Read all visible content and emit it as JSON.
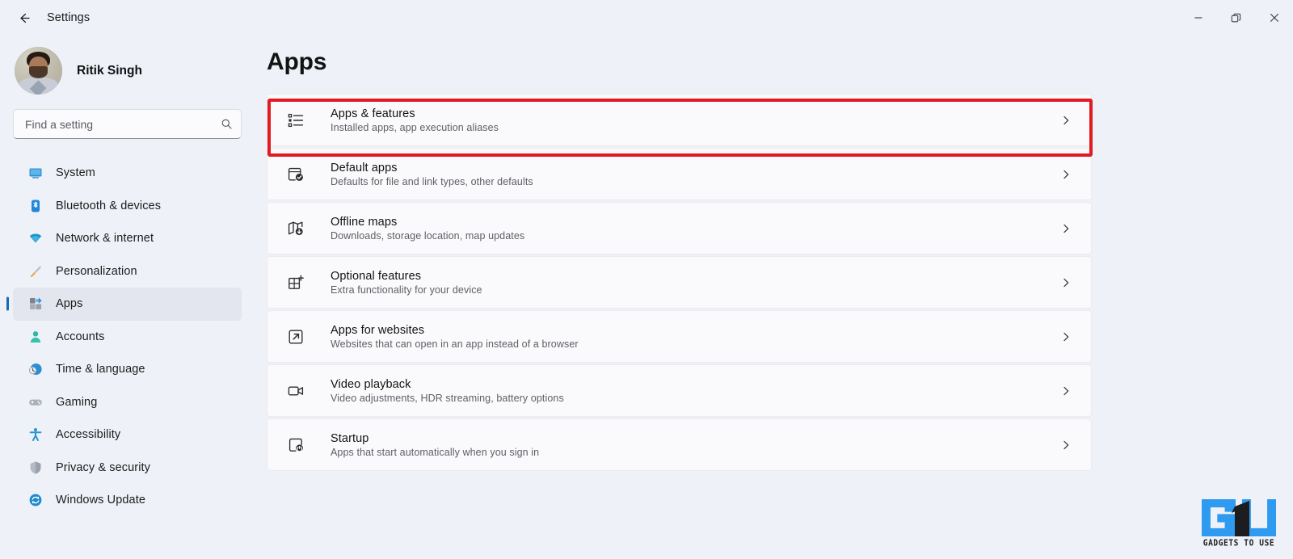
{
  "window": {
    "back_icon": "arrow-left-icon",
    "title": "Settings",
    "controls": {
      "minimize": "minimize-icon",
      "restore": "restore-icon",
      "close": "close-icon"
    }
  },
  "sidebar": {
    "account": {
      "name": "Ritik Singh",
      "avatar": "user-avatar"
    },
    "search": {
      "placeholder": "Find a setting",
      "value": "",
      "icon": "search-icon"
    },
    "items": [
      {
        "label": "System",
        "icon": "monitor-icon",
        "selected": false
      },
      {
        "label": "Bluetooth & devices",
        "icon": "bluetooth-icon",
        "selected": false
      },
      {
        "label": "Network & internet",
        "icon": "wifi-icon",
        "selected": false
      },
      {
        "label": "Personalization",
        "icon": "paintbrush-icon",
        "selected": false
      },
      {
        "label": "Apps",
        "icon": "apps-grid-icon",
        "selected": true
      },
      {
        "label": "Accounts",
        "icon": "person-icon",
        "selected": false
      },
      {
        "label": "Time & language",
        "icon": "clock-globe-icon",
        "selected": false
      },
      {
        "label": "Gaming",
        "icon": "gamepad-icon",
        "selected": false
      },
      {
        "label": "Accessibility",
        "icon": "accessibility-icon",
        "selected": false
      },
      {
        "label": "Privacy & security",
        "icon": "shield-icon",
        "selected": false
      },
      {
        "label": "Windows Update",
        "icon": "update-icon",
        "selected": false
      }
    ]
  },
  "main": {
    "page_title": "Apps",
    "cards": [
      {
        "title": "Apps & features",
        "subtitle": "Installed apps, app execution aliases",
        "icon": "list-bullets-icon",
        "chevron": "chevron-right-icon",
        "highlighted": true
      },
      {
        "title": "Default apps",
        "subtitle": "Defaults for file and link types, other defaults",
        "icon": "window-check-icon",
        "chevron": "chevron-right-icon",
        "highlighted": false
      },
      {
        "title": "Offline maps",
        "subtitle": "Downloads, storage location, map updates",
        "icon": "map-download-icon",
        "chevron": "chevron-right-icon",
        "highlighted": false
      },
      {
        "title": "Optional features",
        "subtitle": "Extra functionality for your device",
        "icon": "grid-plus-icon",
        "chevron": "chevron-right-icon",
        "highlighted": false
      },
      {
        "title": "Apps for websites",
        "subtitle": "Websites that can open in an app instead of a browser",
        "icon": "external-link-box-icon",
        "chevron": "chevron-right-icon",
        "highlighted": false
      },
      {
        "title": "Video playback",
        "subtitle": "Video adjustments, HDR streaming, battery options",
        "icon": "video-camera-icon",
        "chevron": "chevron-right-icon",
        "highlighted": false
      },
      {
        "title": "Startup",
        "subtitle": "Apps that start automatically when you sign in",
        "icon": "startup-power-icon",
        "chevron": "chevron-right-icon",
        "highlighted": false
      }
    ]
  },
  "annotation": {
    "color": "#e01b22",
    "target": "Apps & features"
  },
  "watermark": {
    "text": "GADGETS TO USE",
    "logo_letters": "GU",
    "color": "#2f9bf0"
  },
  "colors": {
    "page_background": "#eef1f8",
    "card_background": "#fafafc",
    "accent": "#0f6cbd",
    "selected_nav": "#e3e6ef",
    "annotation": "#e01b22"
  }
}
